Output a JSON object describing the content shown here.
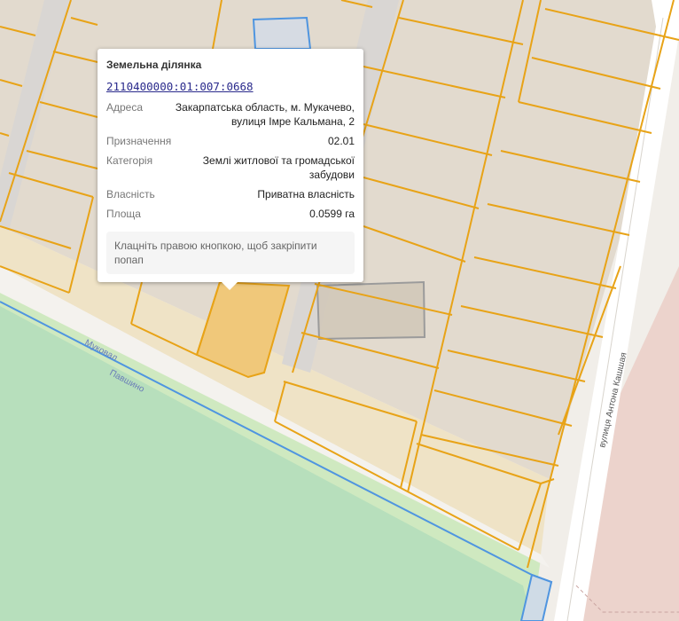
{
  "map": {
    "labels": {
      "street_east": "вулиця Антона Кашшая",
      "street_diag": "Муковал",
      "river": "Павшино"
    },
    "colors": {
      "parcel_border": "#e8a317",
      "selected_fill": "#f0c87a",
      "green_area": "#b8dfbc",
      "boundary": "#4f95e0",
      "pink_area": "#ecd3cc"
    }
  },
  "popup": {
    "title": "Земельна ділянка",
    "cadastral_number": "2110400000:01:007:0668",
    "fields": [
      {
        "label": "Адреса",
        "value": "Закарпатська область, м. Мукачево, вулиця Імре Кальмана, 2"
      },
      {
        "label": "Призначення",
        "value": "02.01"
      },
      {
        "label": "Категорія",
        "value": "Землі житлової та громадської забудови"
      },
      {
        "label": "Власність",
        "value": "Приватна власність"
      },
      {
        "label": "Площа",
        "value": "0.0599 га"
      }
    ],
    "hint": "Клацніть правою кнопкою, щоб закріпити попап"
  }
}
